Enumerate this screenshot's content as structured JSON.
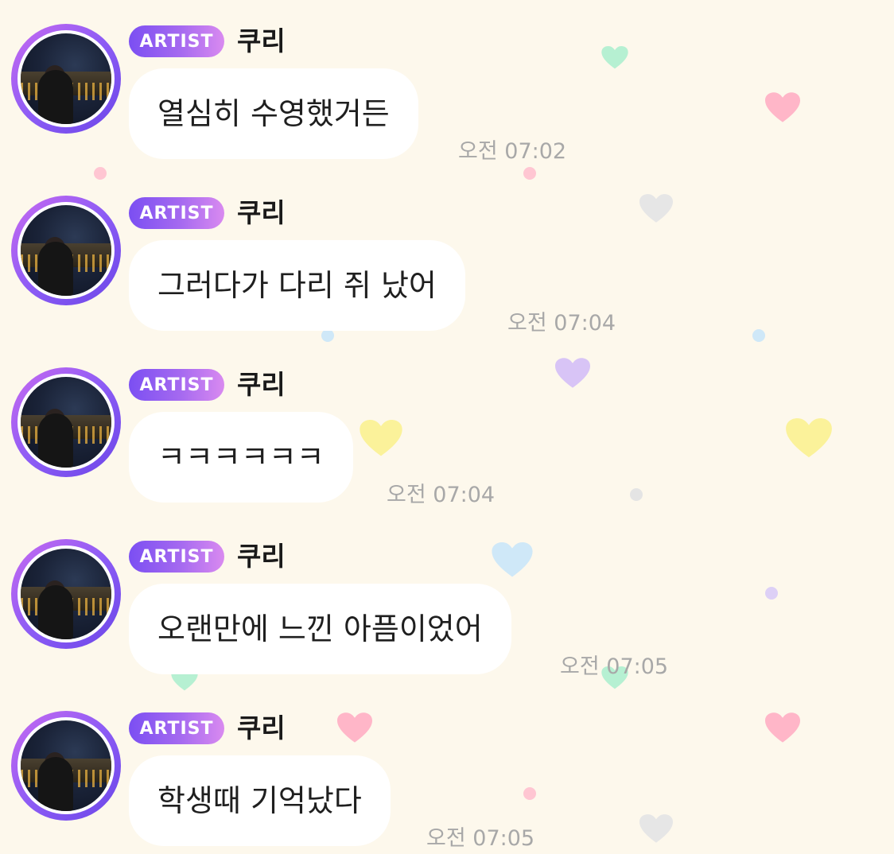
{
  "badge_label": "ARTIST",
  "colors": {
    "background": "#fdf8ec",
    "badge_gradient_start": "#7b4ff2",
    "badge_gradient_end": "#d98af0",
    "bubble": "#ffffff",
    "timestamp": "#a8a8a8"
  },
  "messages": [
    {
      "sender": "쿠리",
      "text": "열심히 수영했거든",
      "time": "오전 07:02"
    },
    {
      "sender": "쿠리",
      "text": "그러다가 다리 쥐 났어",
      "time": "오전 07:04"
    },
    {
      "sender": "쿠리",
      "text": "ㅋㅋㅋㅋㅋㅋ",
      "time": "오전 07:04"
    },
    {
      "sender": "쿠리",
      "text": "오랜만에 느낀 아픔이었어",
      "time": "오전 07:05"
    },
    {
      "sender": "쿠리",
      "text": "학생때 기억났다",
      "time": "오전 07:05"
    }
  ],
  "decorations": [
    "heart-icon",
    "dot"
  ]
}
